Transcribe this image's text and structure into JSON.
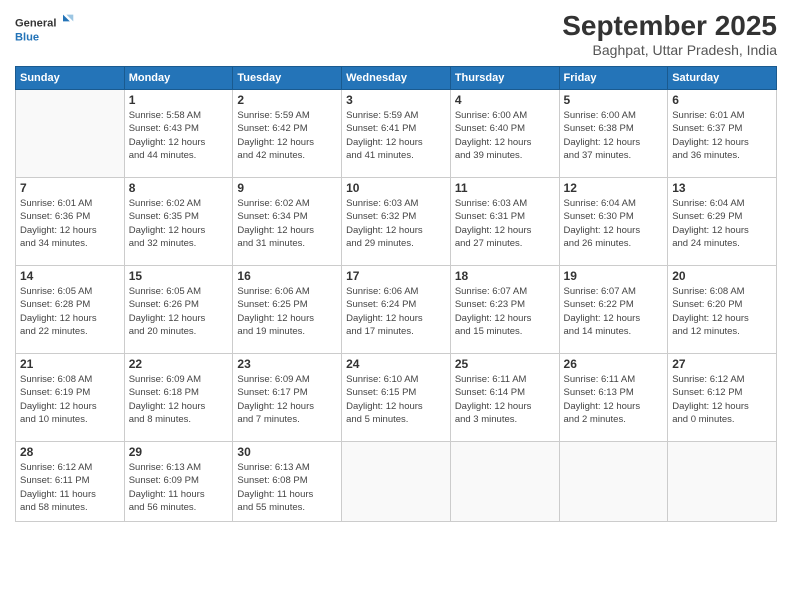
{
  "logo": {
    "line1": "General",
    "line2": "Blue"
  },
  "header": {
    "month": "September 2025",
    "location": "Baghpat, Uttar Pradesh, India"
  },
  "weekdays": [
    "Sunday",
    "Monday",
    "Tuesday",
    "Wednesday",
    "Thursday",
    "Friday",
    "Saturday"
  ],
  "weeks": [
    [
      {
        "day": "",
        "info": ""
      },
      {
        "day": "1",
        "info": "Sunrise: 5:58 AM\nSunset: 6:43 PM\nDaylight: 12 hours\nand 44 minutes."
      },
      {
        "day": "2",
        "info": "Sunrise: 5:59 AM\nSunset: 6:42 PM\nDaylight: 12 hours\nand 42 minutes."
      },
      {
        "day": "3",
        "info": "Sunrise: 5:59 AM\nSunset: 6:41 PM\nDaylight: 12 hours\nand 41 minutes."
      },
      {
        "day": "4",
        "info": "Sunrise: 6:00 AM\nSunset: 6:40 PM\nDaylight: 12 hours\nand 39 minutes."
      },
      {
        "day": "5",
        "info": "Sunrise: 6:00 AM\nSunset: 6:38 PM\nDaylight: 12 hours\nand 37 minutes."
      },
      {
        "day": "6",
        "info": "Sunrise: 6:01 AM\nSunset: 6:37 PM\nDaylight: 12 hours\nand 36 minutes."
      }
    ],
    [
      {
        "day": "7",
        "info": "Sunrise: 6:01 AM\nSunset: 6:36 PM\nDaylight: 12 hours\nand 34 minutes."
      },
      {
        "day": "8",
        "info": "Sunrise: 6:02 AM\nSunset: 6:35 PM\nDaylight: 12 hours\nand 32 minutes."
      },
      {
        "day": "9",
        "info": "Sunrise: 6:02 AM\nSunset: 6:34 PM\nDaylight: 12 hours\nand 31 minutes."
      },
      {
        "day": "10",
        "info": "Sunrise: 6:03 AM\nSunset: 6:32 PM\nDaylight: 12 hours\nand 29 minutes."
      },
      {
        "day": "11",
        "info": "Sunrise: 6:03 AM\nSunset: 6:31 PM\nDaylight: 12 hours\nand 27 minutes."
      },
      {
        "day": "12",
        "info": "Sunrise: 6:04 AM\nSunset: 6:30 PM\nDaylight: 12 hours\nand 26 minutes."
      },
      {
        "day": "13",
        "info": "Sunrise: 6:04 AM\nSunset: 6:29 PM\nDaylight: 12 hours\nand 24 minutes."
      }
    ],
    [
      {
        "day": "14",
        "info": "Sunrise: 6:05 AM\nSunset: 6:28 PM\nDaylight: 12 hours\nand 22 minutes."
      },
      {
        "day": "15",
        "info": "Sunrise: 6:05 AM\nSunset: 6:26 PM\nDaylight: 12 hours\nand 20 minutes."
      },
      {
        "day": "16",
        "info": "Sunrise: 6:06 AM\nSunset: 6:25 PM\nDaylight: 12 hours\nand 19 minutes."
      },
      {
        "day": "17",
        "info": "Sunrise: 6:06 AM\nSunset: 6:24 PM\nDaylight: 12 hours\nand 17 minutes."
      },
      {
        "day": "18",
        "info": "Sunrise: 6:07 AM\nSunset: 6:23 PM\nDaylight: 12 hours\nand 15 minutes."
      },
      {
        "day": "19",
        "info": "Sunrise: 6:07 AM\nSunset: 6:22 PM\nDaylight: 12 hours\nand 14 minutes."
      },
      {
        "day": "20",
        "info": "Sunrise: 6:08 AM\nSunset: 6:20 PM\nDaylight: 12 hours\nand 12 minutes."
      }
    ],
    [
      {
        "day": "21",
        "info": "Sunrise: 6:08 AM\nSunset: 6:19 PM\nDaylight: 12 hours\nand 10 minutes."
      },
      {
        "day": "22",
        "info": "Sunrise: 6:09 AM\nSunset: 6:18 PM\nDaylight: 12 hours\nand 8 minutes."
      },
      {
        "day": "23",
        "info": "Sunrise: 6:09 AM\nSunset: 6:17 PM\nDaylight: 12 hours\nand 7 minutes."
      },
      {
        "day": "24",
        "info": "Sunrise: 6:10 AM\nSunset: 6:15 PM\nDaylight: 12 hours\nand 5 minutes."
      },
      {
        "day": "25",
        "info": "Sunrise: 6:11 AM\nSunset: 6:14 PM\nDaylight: 12 hours\nand 3 minutes."
      },
      {
        "day": "26",
        "info": "Sunrise: 6:11 AM\nSunset: 6:13 PM\nDaylight: 12 hours\nand 2 minutes."
      },
      {
        "day": "27",
        "info": "Sunrise: 6:12 AM\nSunset: 6:12 PM\nDaylight: 12 hours\nand 0 minutes."
      }
    ],
    [
      {
        "day": "28",
        "info": "Sunrise: 6:12 AM\nSunset: 6:11 PM\nDaylight: 11 hours\nand 58 minutes."
      },
      {
        "day": "29",
        "info": "Sunrise: 6:13 AM\nSunset: 6:09 PM\nDaylight: 11 hours\nand 56 minutes."
      },
      {
        "day": "30",
        "info": "Sunrise: 6:13 AM\nSunset: 6:08 PM\nDaylight: 11 hours\nand 55 minutes."
      },
      {
        "day": "",
        "info": ""
      },
      {
        "day": "",
        "info": ""
      },
      {
        "day": "",
        "info": ""
      },
      {
        "day": "",
        "info": ""
      }
    ]
  ]
}
